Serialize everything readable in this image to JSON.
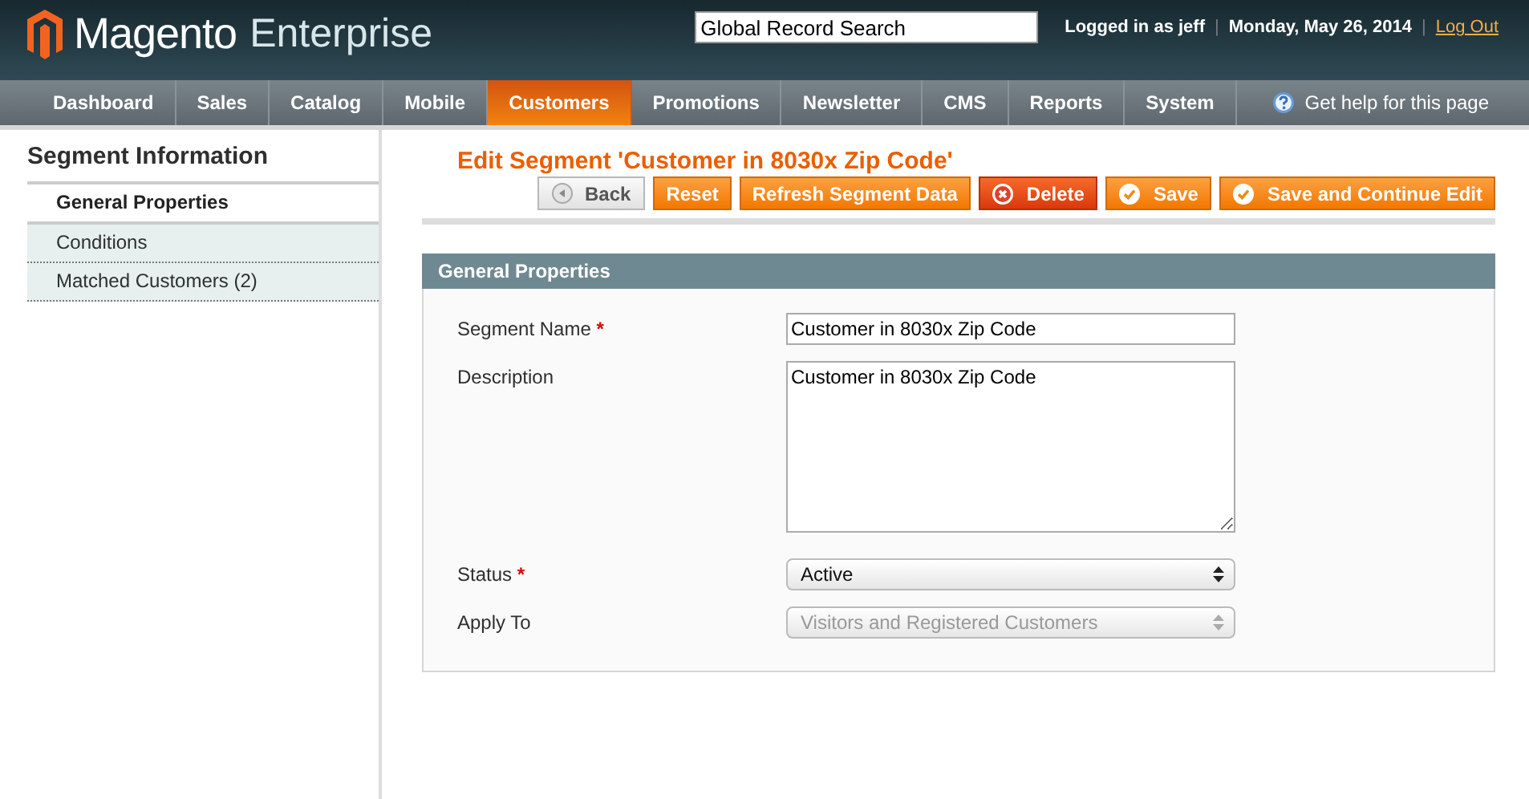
{
  "header": {
    "logo": {
      "brand": "Magento",
      "edition": "Enterprise"
    },
    "search": {
      "value": "Global Record Search"
    },
    "meta": [
      {
        "kind": "text",
        "text": "Logged in as jeff"
      },
      {
        "kind": "separator",
        "text": "|"
      },
      {
        "kind": "text",
        "text": "Monday, May 26, 2014"
      },
      {
        "kind": "separator",
        "text": "|"
      },
      {
        "kind": "link",
        "text": "Log Out"
      }
    ]
  },
  "nav": {
    "items": [
      {
        "label": "Dashboard",
        "selected": false
      },
      {
        "label": "Sales",
        "selected": false
      },
      {
        "label": "Catalog",
        "selected": false
      },
      {
        "label": "Mobile",
        "selected": false
      },
      {
        "label": "Customers",
        "selected": true
      },
      {
        "label": "Promotions",
        "selected": false
      },
      {
        "label": "Newsletter",
        "selected": false
      },
      {
        "label": "CMS",
        "selected": false
      },
      {
        "label": "Reports",
        "selected": false
      },
      {
        "label": "System",
        "selected": false
      }
    ],
    "help": "Get help for this page"
  },
  "sidebar": {
    "title": "Segment Information",
    "tabs": [
      {
        "label": "General Properties",
        "selected": true
      },
      {
        "label": "Conditions",
        "selected": false
      },
      {
        "label": "Matched Customers (2)",
        "selected": false
      }
    ]
  },
  "page_title": "Edit Segment 'Customer in 8030x Zip Code'",
  "buttons": [
    {
      "kind": "back",
      "label": "Back"
    },
    {
      "kind": "plain",
      "label": "Reset"
    },
    {
      "kind": "plain",
      "label": "Refresh Segment Data"
    },
    {
      "kind": "delete",
      "label": "Delete"
    },
    {
      "kind": "save",
      "label": "Save"
    },
    {
      "kind": "save",
      "label": "Save and Continue Edit"
    }
  ],
  "fieldset": {
    "title": "General Properties",
    "fields": [
      {
        "kind": "text",
        "label": "Segment Name",
        "mark": "*",
        "value": "Customer in 8030x Zip Code",
        "disabled": false
      },
      {
        "kind": "textarea",
        "label": "Description",
        "value": "Customer in 8030x Zip Code",
        "disabled": false
      },
      {
        "kind": "select",
        "label": "Status",
        "mark": "*",
        "value": "Active",
        "disabled": false
      },
      {
        "kind": "select",
        "label": "Apply To",
        "value": "Visitors and Registered Customers",
        "disabled": true
      }
    ]
  }
}
